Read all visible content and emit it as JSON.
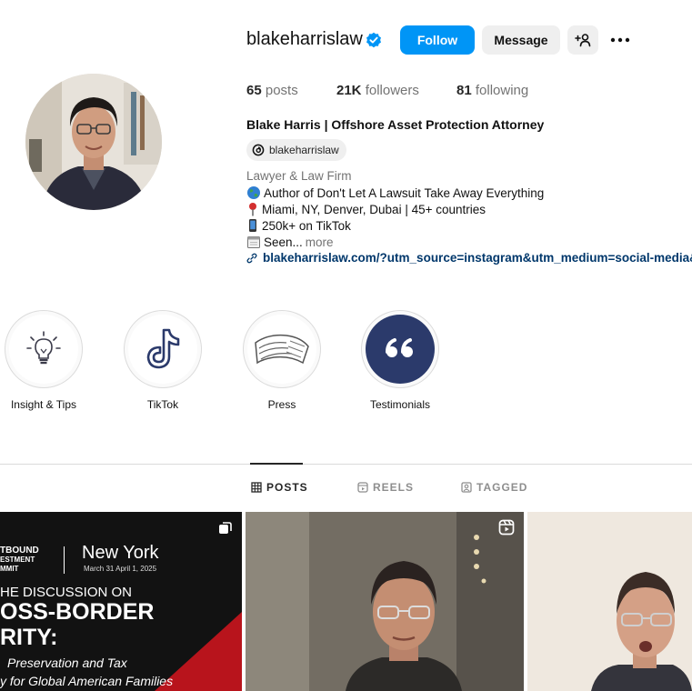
{
  "profile": {
    "username": "blakeharrislaw",
    "follow_label": "Follow",
    "message_label": "Message",
    "add_user_label": "+&",
    "stats": {
      "posts_count": "65",
      "posts_label": "posts",
      "followers_count": "21K",
      "followers_label": "followers",
      "following_count": "81",
      "following_label": "following"
    },
    "full_name": "Blake Harris | Offshore Asset Protection Attorney",
    "threads_handle": "blakeharrislaw",
    "category": "Lawyer & Law Firm",
    "bio": [
      {
        "icon": "globe-icon",
        "text": "Author of Don't Let A Lawsuit Take Away Everything"
      },
      {
        "icon": "pin-icon",
        "text": "Miami, NY, Denver, Dubai | 45+ countries"
      },
      {
        "icon": "phone-icon",
        "text": "250k+ on TikTok"
      },
      {
        "icon": "calendar-icon",
        "text": "Seen...",
        "more": "more"
      }
    ],
    "link": "blakeharrislaw.com/?utm_source=instagram&utm_medium=social-media&u"
  },
  "highlights": [
    {
      "label": "Insight & Tips",
      "icon": "lightbulb-icon"
    },
    {
      "label": "TikTok",
      "icon": "tiktok-icon"
    },
    {
      "label": "Press",
      "icon": "newspaper-icon"
    },
    {
      "label": "Testimonials",
      "icon": "quote-icon"
    }
  ],
  "tabs": [
    {
      "label": "POSTS",
      "icon": "grid-icon",
      "active": true
    },
    {
      "label": "REELS",
      "icon": "reels-icon",
      "active": false
    },
    {
      "label": "TAGGED",
      "icon": "tagged-icon",
      "active": false
    }
  ],
  "posts": [
    {
      "type": "carousel",
      "brand_line1": "TBOUND",
      "brand_line2": "ESTMENT",
      "brand_line3": "MMIT",
      "city": "New York",
      "date": "March 31 April 1, 2025",
      "line1": "HE DISCUSSION ON",
      "line2": "OSS-BORDER",
      "line3": "RITY:",
      "line4": "Preservation and Tax",
      "line5": "y for Global American Families"
    },
    {
      "type": "reel"
    },
    {
      "type": "video"
    }
  ],
  "colors": {
    "accent": "#0095f6",
    "link": "#00376b",
    "muted": "#737373",
    "highlight_navy": "#2b3a6b",
    "post_red": "#b8141c"
  }
}
